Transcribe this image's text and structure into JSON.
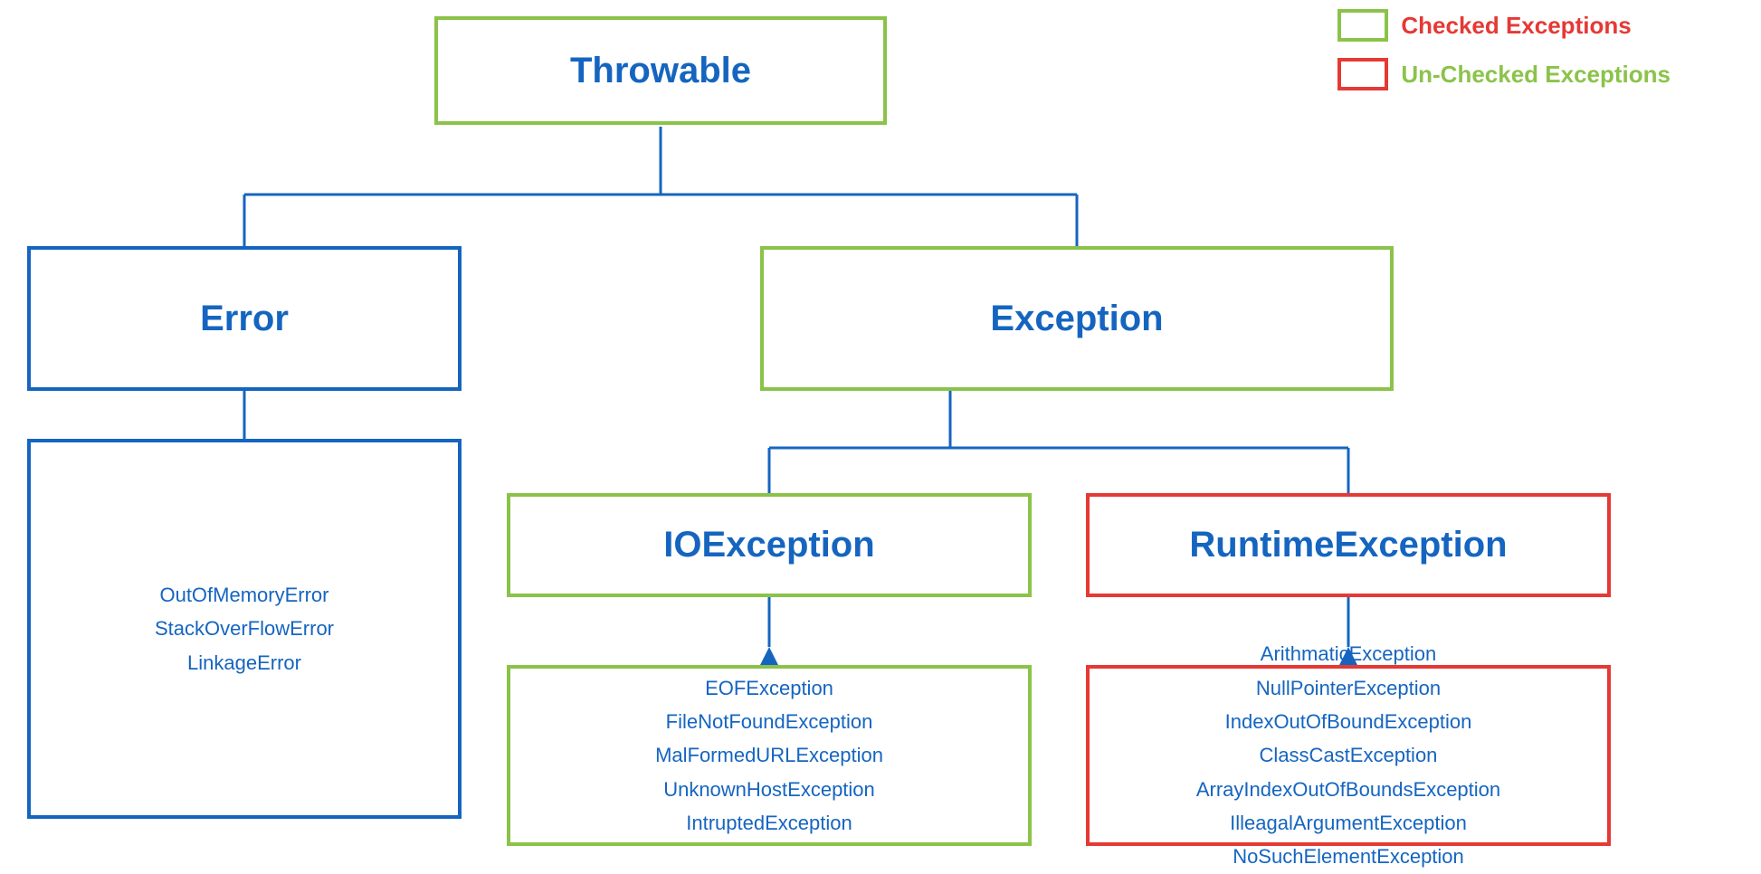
{
  "legend": {
    "checked_label": "Checked Exceptions",
    "unchecked_label": "Un-Checked Exceptions"
  },
  "nodes": {
    "throwable": {
      "label": "Throwable",
      "border": "green"
    },
    "error": {
      "label": "Error",
      "border": "blue"
    },
    "exception": {
      "label": "Exception",
      "border": "green"
    },
    "ioexception": {
      "label": "IOException",
      "border": "green"
    },
    "runtimeexception": {
      "label": "RuntimeException",
      "border": "red"
    },
    "error_children": {
      "items": [
        "OutOfMemoryError",
        "StackOverFlowError",
        "LinkageError"
      ]
    },
    "ioexception_children": {
      "items": [
        "EOFException",
        "FileNotFoundException",
        "MalFormedURLException",
        "UnknownHostException",
        "IntruptedException"
      ]
    },
    "runtime_children": {
      "items": [
        "ArithmaticException",
        "NullPointerException",
        "IndexOutOfBoundException",
        "ClassCastException",
        "ArrayIndexOutOfBoundsException",
        "IlleagalArgumentException",
        "NoSuchElementException"
      ]
    }
  }
}
